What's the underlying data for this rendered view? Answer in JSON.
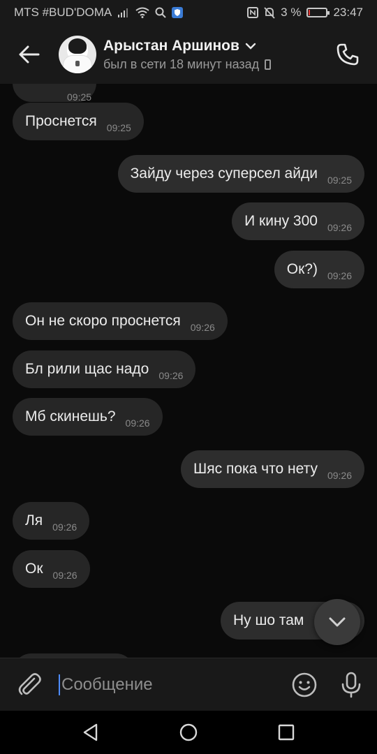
{
  "status_bar": {
    "carrier": "MTS #BUD'DOMA",
    "battery": "3 %",
    "time": "23:47",
    "battery_level": 0.03,
    "battery_color": "#e53935"
  },
  "header": {
    "contact_name": "Арыстан Аршинов",
    "contact_status": "был в сети 18 минут назад"
  },
  "messages": [
    {
      "text": "Проснется",
      "time": "09:25",
      "dir": "in"
    },
    {
      "text": "Зайду через суперсел айди",
      "time": "09:25",
      "dir": "out"
    },
    {
      "text": "И кину 300",
      "time": "09:26",
      "dir": "out"
    },
    {
      "text": "Ок?)",
      "time": "09:26",
      "dir": "out"
    },
    {
      "text": "Он не скоро проснется",
      "time": "09:26",
      "dir": "in"
    },
    {
      "text": "Бл рили щас надо",
      "time": "09:26",
      "dir": "in"
    },
    {
      "text": "Мб скинешь?",
      "time": "09:26",
      "dir": "in"
    },
    {
      "text": "Шяс пока что нету",
      "time": "09:26",
      "dir": "out"
    },
    {
      "text": "Ля",
      "time": "09:26",
      "dir": "in"
    },
    {
      "text": "Ок",
      "time": "09:26",
      "dir": "in"
    },
    {
      "text": "Ну шо там",
      "time": "",
      "dir": "out"
    }
  ],
  "partial_top_time": "09:25",
  "composer": {
    "placeholder": "Сообщение"
  },
  "colors": {
    "background": "#0a0a0a",
    "bar": "#191919",
    "bubble_in": "#262626",
    "bubble_out": "#2d2d2d",
    "caret": "#4d8cff"
  },
  "icons": [
    "back-arrow-icon",
    "chevron-down-icon",
    "phone-icon",
    "paperclip-icon",
    "emoji-icon",
    "microphone-icon",
    "scroll-down-icon",
    "nav-back-icon",
    "nav-home-icon",
    "nav-recents-icon"
  ]
}
